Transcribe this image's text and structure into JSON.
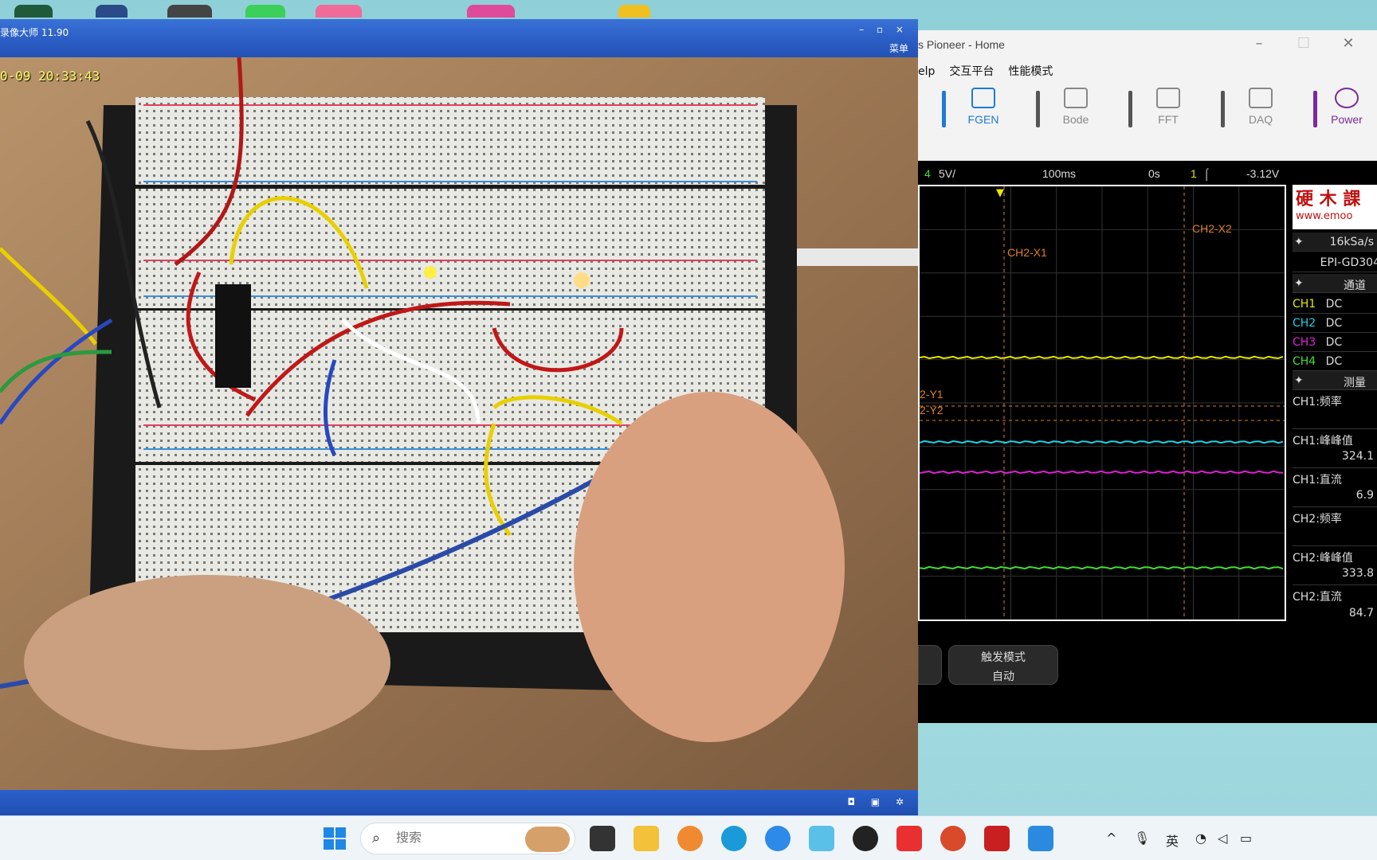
{
  "camera_window": {
    "title": "录像大师 11.90",
    "window_buttons": "– ▫ ×",
    "menu_label": "菜单",
    "timestamp": "0-09 20:33:43",
    "status_icons": "◘ ▣ ✲"
  },
  "scope_window": {
    "title": "s Pioneer - Home",
    "win_controls": {
      "minimize": "–",
      "maximize": "☐",
      "close": "✕"
    },
    "menu": {
      "help": "elp",
      "interactive": "交互平台",
      "performance": "性能模式"
    },
    "toolbar": {
      "fgen": "FGEN",
      "bode": "Bode",
      "fft": "FFT",
      "daq": "DAQ",
      "power": "Power"
    },
    "status": {
      "channel": "4",
      "volts_div": "5V/",
      "time_div": "100ms",
      "offset": "0s",
      "trigger_ch": "1",
      "trigger_level": "-3.12V"
    },
    "cursors": {
      "ch2_x1": "CH2-X1",
      "ch2_x2": "CH2-X2",
      "y1": "2-Y1",
      "y2": "2-Y2"
    },
    "trace_colors": {
      "ch1": "#e8e800",
      "ch2": "#1ad4e8",
      "ch3": "#e020d8",
      "ch4": "#40e030"
    },
    "panel": {
      "brand_cn": "硬 木 課",
      "brand_url": "www.emoo",
      "sample_rate": "16kSa/s",
      "device": "EPI-GD304",
      "channels_header": "通道",
      "channels": [
        {
          "name": "CH1",
          "coupling": "DC",
          "color": "#e8e800"
        },
        {
          "name": "CH2",
          "coupling": "DC",
          "color": "#1ad4e8"
        },
        {
          "name": "CH3",
          "coupling": "DC",
          "color": "#e020d8"
        },
        {
          "name": "CH4",
          "coupling": "DC",
          "color": "#40e030"
        }
      ],
      "measure_header": "测量",
      "measurements": [
        {
          "label": "CH1:频率",
          "value": ""
        },
        {
          "label": "CH1:峰峰值",
          "value": "324.1"
        },
        {
          "label": "CH1:直流",
          "value": "6.9"
        },
        {
          "label": "CH2:频率",
          "value": ""
        },
        {
          "label": "CH2:峰峰值",
          "value": "333.8"
        },
        {
          "label": "CH2:直流",
          "value": "84.7"
        }
      ]
    },
    "bottom": {
      "trigger_mode_label": "触发模式",
      "trigger_mode_value": "自动"
    }
  },
  "taskbar": {
    "search_placeholder": "搜索",
    "ime": "英"
  }
}
